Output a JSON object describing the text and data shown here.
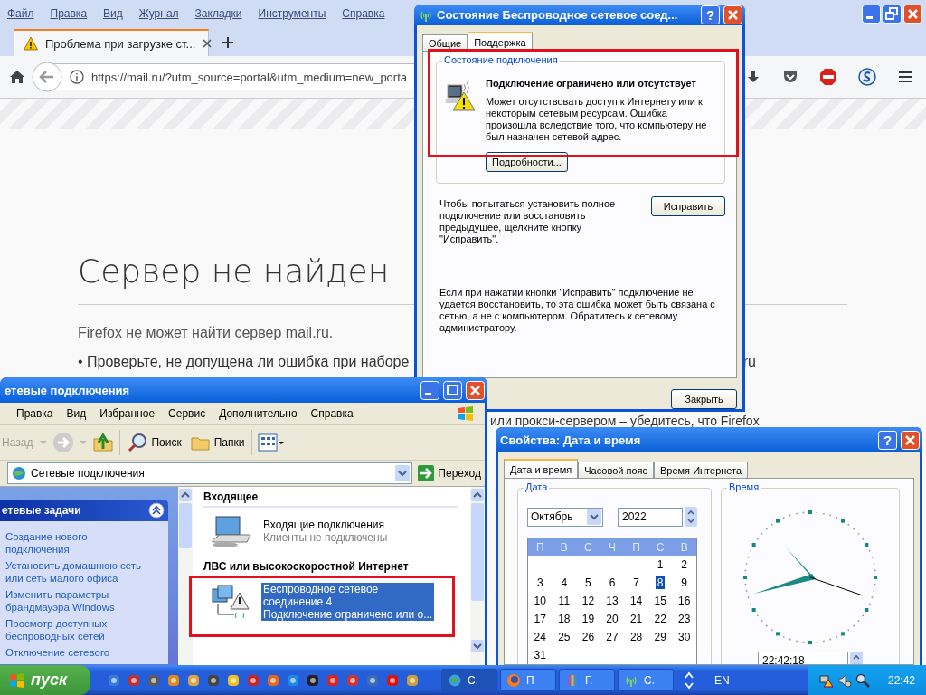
{
  "browser": {
    "menu": [
      "Файл",
      "Правка",
      "Вид",
      "Журнал",
      "Закладки",
      "Инструменты",
      "Справка"
    ],
    "tab": {
      "title": "Проблема при загрузке ст..."
    },
    "url": "https://mail.ru/?utm_source=portal&utm_medium=new_porta",
    "page": {
      "heading": "Сервер не найден",
      "message": "Firefox не может найти сервер mail.ru.",
      "bullet": "• Проверьте, не допущена ли ошибка при наборе",
      "bullet_tail": "ru",
      "line_2": "или прокси-сервером – убедитесь, что Firefox"
    }
  },
  "status_dialog": {
    "title": "Состояние Беспроводное сетевое соед...",
    "help": "?",
    "tabs": [
      {
        "label": "Общие",
        "selected": false
      },
      {
        "label": "Поддержка",
        "selected": true
      }
    ],
    "group": {
      "title": "Состояние подключения",
      "highlighted": true,
      "heading": "Подключение ограничено или отсутствует",
      "description": [
        "Может отсутствовать доступ к Интернету или к",
        "некоторым сетевым ресурсам. Ошибка",
        "произошла вследствие того, что компьютеру не",
        "был назначен сетевой адрес."
      ],
      "button": "Подробности..."
    },
    "repair_text": [
      "Чтобы попытаться установить полное",
      "подключение или восстановить",
      "предыдущее, щелкните кнопку",
      "\"Исправить\"."
    ],
    "repair_button": "Исправить",
    "note": [
      "Если при нажатии кнопки \"Исправить\" подключение не",
      "удается восстановить, то эта ошибка может быть связана с",
      "сетью, а не с компьютером.  Обратитесь к сетевому",
      "администратору."
    ],
    "close_button": "Закрыть"
  },
  "explorer": {
    "title": "етевые подключения",
    "menu": [
      "Правка",
      "Вид",
      "Избранное",
      "Сервис",
      "Дополнительно",
      "Справка"
    ],
    "toolbar": {
      "back": "Назад",
      "search": "Поиск",
      "folders": "Папки"
    },
    "address": "Сетевые подключения",
    "go": "Переход",
    "tasks": {
      "title": "етевые задачи",
      "expanded": true,
      "links": [
        [
          "Создание нового",
          "подключения"
        ],
        [
          "Установить домашнюю сеть",
          "или сеть малого офиса"
        ],
        [
          "Изменить параметры",
          "брандмауэра Windows"
        ],
        [
          "Просмотр доступных",
          "беспроводных сетей"
        ],
        [
          "Отключение сетевого"
        ]
      ]
    },
    "groups": [
      {
        "title": "Входящее",
        "items": [
          {
            "kind": "incoming",
            "name_lines": [
              "Входящие подключения"
            ],
            "status": "Клиенты не подключены",
            "selected": false,
            "highlighted": false
          }
        ]
      },
      {
        "title": "ЛВС или высокоскоростной Интернет",
        "items": [
          {
            "kind": "wireless",
            "name_lines": [
              "Беспроводное сетевое",
              "соединение 4"
            ],
            "status": "Подключение ограничено или о...",
            "selected": true,
            "highlighted": true
          }
        ]
      }
    ]
  },
  "date_dialog": {
    "title": "Свойства: Дата и время",
    "help": "?",
    "tabs": [
      {
        "label": "Дата и время",
        "selected": true
      },
      {
        "label": "Часовой пояс",
        "selected": false
      },
      {
        "label": "Время Интернета",
        "selected": false
      }
    ],
    "date_group": "Дата",
    "month": "Октябрь",
    "year": "2022",
    "weekdays": [
      "П",
      "В",
      "С",
      "Ч",
      "П",
      "С",
      "В"
    ],
    "weeks": [
      [
        {
          "day": "1",
          "selected": false
        },
        {
          "day": "2",
          "selected": false
        }
      ],
      [
        {
          "day": "3",
          "selected": false
        },
        {
          "day": "4",
          "selected": false
        },
        {
          "day": "5",
          "selected": false
        },
        {
          "day": "6",
          "selected": false
        },
        {
          "day": "7",
          "selected": false
        },
        {
          "day": "8",
          "selected": true
        },
        {
          "day": "9",
          "selected": false
        }
      ],
      [
        {
          "day": "10",
          "selected": false
        },
        {
          "day": "11",
          "selected": false
        },
        {
          "day": "12",
          "selected": false
        },
        {
          "day": "13",
          "selected": false
        },
        {
          "day": "14",
          "selected": false
        },
        {
          "day": "15",
          "selected": false
        },
        {
          "day": "16",
          "selected": false
        }
      ],
      [
        {
          "day": "17",
          "selected": false
        },
        {
          "day": "18",
          "selected": false
        },
        {
          "day": "19",
          "selected": false
        },
        {
          "day": "20",
          "selected": false
        },
        {
          "day": "21",
          "selected": false
        },
        {
          "day": "22",
          "selected": false
        },
        {
          "day": "23",
          "selected": false
        }
      ],
      [
        {
          "day": "24",
          "selected": false
        },
        {
          "day": "25",
          "selected": false
        },
        {
          "day": "26",
          "selected": false
        },
        {
          "day": "27",
          "selected": false
        },
        {
          "day": "28",
          "selected": false
        },
        {
          "day": "29",
          "selected": false
        },
        {
          "day": "30",
          "selected": false
        }
      ],
      [
        {
          "day": "31",
          "selected": false
        }
      ]
    ],
    "time_group": "Время",
    "time": "22:42:18"
  },
  "taskbar": {
    "start": "пуск",
    "tasks": [
      {
        "kind": "network",
        "label": "С.",
        "selected": true
      },
      {
        "kind": "firefox",
        "label": "П",
        "selected": false
      },
      {
        "kind": "archive",
        "label": "Г.",
        "selected": false
      },
      {
        "kind": "wireless",
        "label": "С.",
        "selected": false
      }
    ],
    "language": "EN",
    "clock": "22:42"
  }
}
